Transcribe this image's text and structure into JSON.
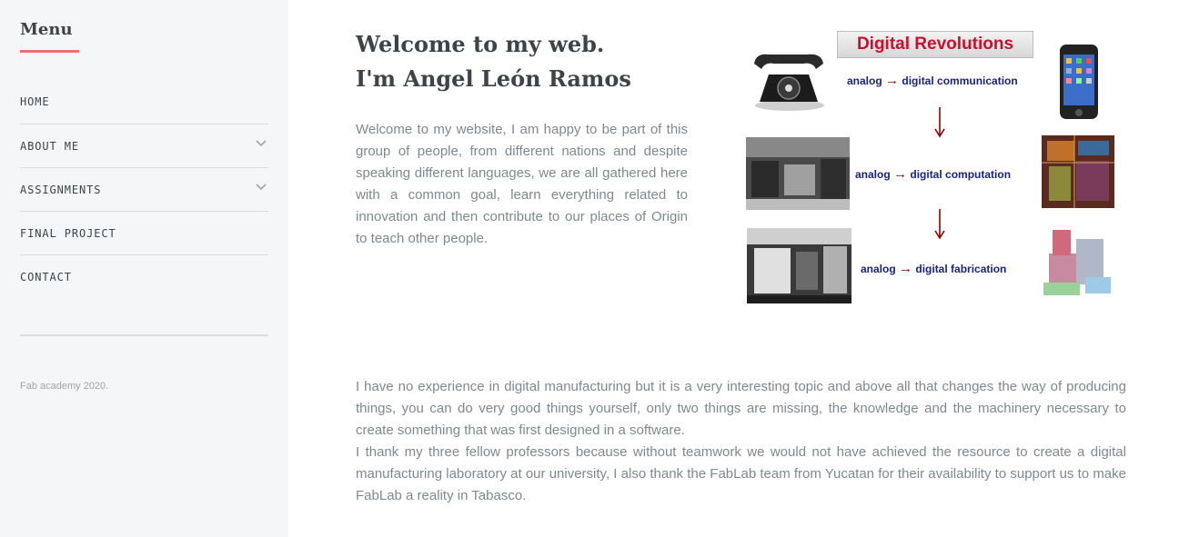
{
  "sidebar": {
    "title": "Menu",
    "items": [
      {
        "label": "HOME"
      },
      {
        "label": "ABOUT ME"
      },
      {
        "label": "ASSIGNMENTS"
      },
      {
        "label": "FINAL PROJECT"
      },
      {
        "label": "CONTACT"
      }
    ],
    "footer": "Fab academy 2020."
  },
  "main": {
    "title_line1": "Welcome to my web.",
    "title_line2": "I'm Angel León Ramos",
    "intro": "Welcome to my website, I am happy to be part of this group of people, from different nations and despite speaking different languages, we are all gathered here with a common goal, learn everything related to innovation and then contribute to our places of Origin to teach other people.",
    "paragraph1": "I have no experience in digital manufacturing but it is a very interesting topic and above all that changes the way of producing things, you can do very good things yourself, only two things are missing, the knowledge and the machinery necessary to create something that was first designed in a software.",
    "paragraph2": "I thank my three fellow professors because without teamwork we would not have achieved the resource to create a digital manufacturing laboratory at our university, I also thank the FabLab team from Yucatan for their availability to support us to make FabLab a reality in Tabasco."
  },
  "figure": {
    "banner": "Digital Revolutions",
    "rows": [
      {
        "from": "analog",
        "arrow": "→",
        "to": "digital communication"
      },
      {
        "from": "analog",
        "arrow": "→",
        "to": "digital computation"
      },
      {
        "from": "analog",
        "arrow": "→",
        "to": "digital fabrication"
      }
    ]
  },
  "colors": {
    "accent": "#f56a6a",
    "heading": "#3d4449",
    "text": "#7f888f",
    "sidebar_bg": "#f5f6f7"
  }
}
